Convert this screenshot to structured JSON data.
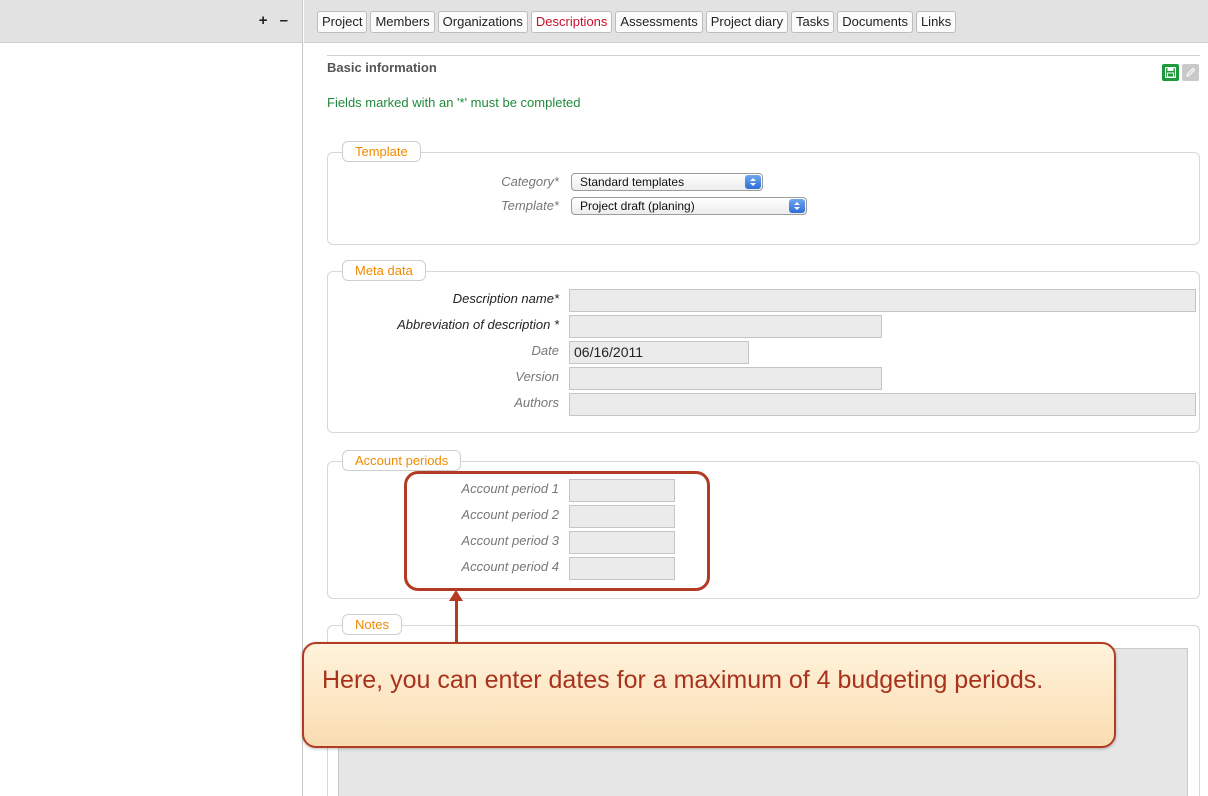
{
  "sidebar": {
    "expand_label": "+",
    "collapse_label": "–"
  },
  "tabs": [
    {
      "label": "Project"
    },
    {
      "label": "Members"
    },
    {
      "label": "Organizations"
    },
    {
      "label": "Descriptions",
      "active": true
    },
    {
      "label": "Assessments"
    },
    {
      "label": "Project diary"
    },
    {
      "label": "Tasks"
    },
    {
      "label": "Documents"
    },
    {
      "label": "Links"
    }
  ],
  "basic_info": {
    "title": "Basic information",
    "required_note": "Fields marked with an '*' must be completed",
    "icons": [
      "save-icon",
      "edit-pencil-icon"
    ]
  },
  "template_section": {
    "legend": "Template",
    "category_label": "Category*",
    "category_value": "Standard templates",
    "template_label": "Template*",
    "template_value": "Project draft (planing)"
  },
  "meta_section": {
    "legend": "Meta data",
    "description_name_label": "Description name*",
    "description_name_value": "",
    "abbreviation_label": "Abbreviation of description *",
    "abbreviation_value": "",
    "date_label": "Date",
    "date_value": "06/16/2011",
    "version_label": "Version",
    "version_value": "",
    "authors_label": "Authors",
    "authors_value": ""
  },
  "account_section": {
    "legend": "Account periods",
    "periods": [
      {
        "label": "Account period 1",
        "value": ""
      },
      {
        "label": "Account period 2",
        "value": ""
      },
      {
        "label": "Account period 3",
        "value": ""
      },
      {
        "label": "Account period 4",
        "value": ""
      }
    ]
  },
  "notes_section": {
    "legend": "Notes",
    "value": ""
  },
  "tooltip": {
    "text": "Here, you can enter dates for a maximum of 4 budgeting periods."
  },
  "colors": {
    "accent_red": "#c8102e",
    "legend_orange": "#f08b00",
    "note_green": "#1f8a3b",
    "callout_border": "#b33a23"
  }
}
